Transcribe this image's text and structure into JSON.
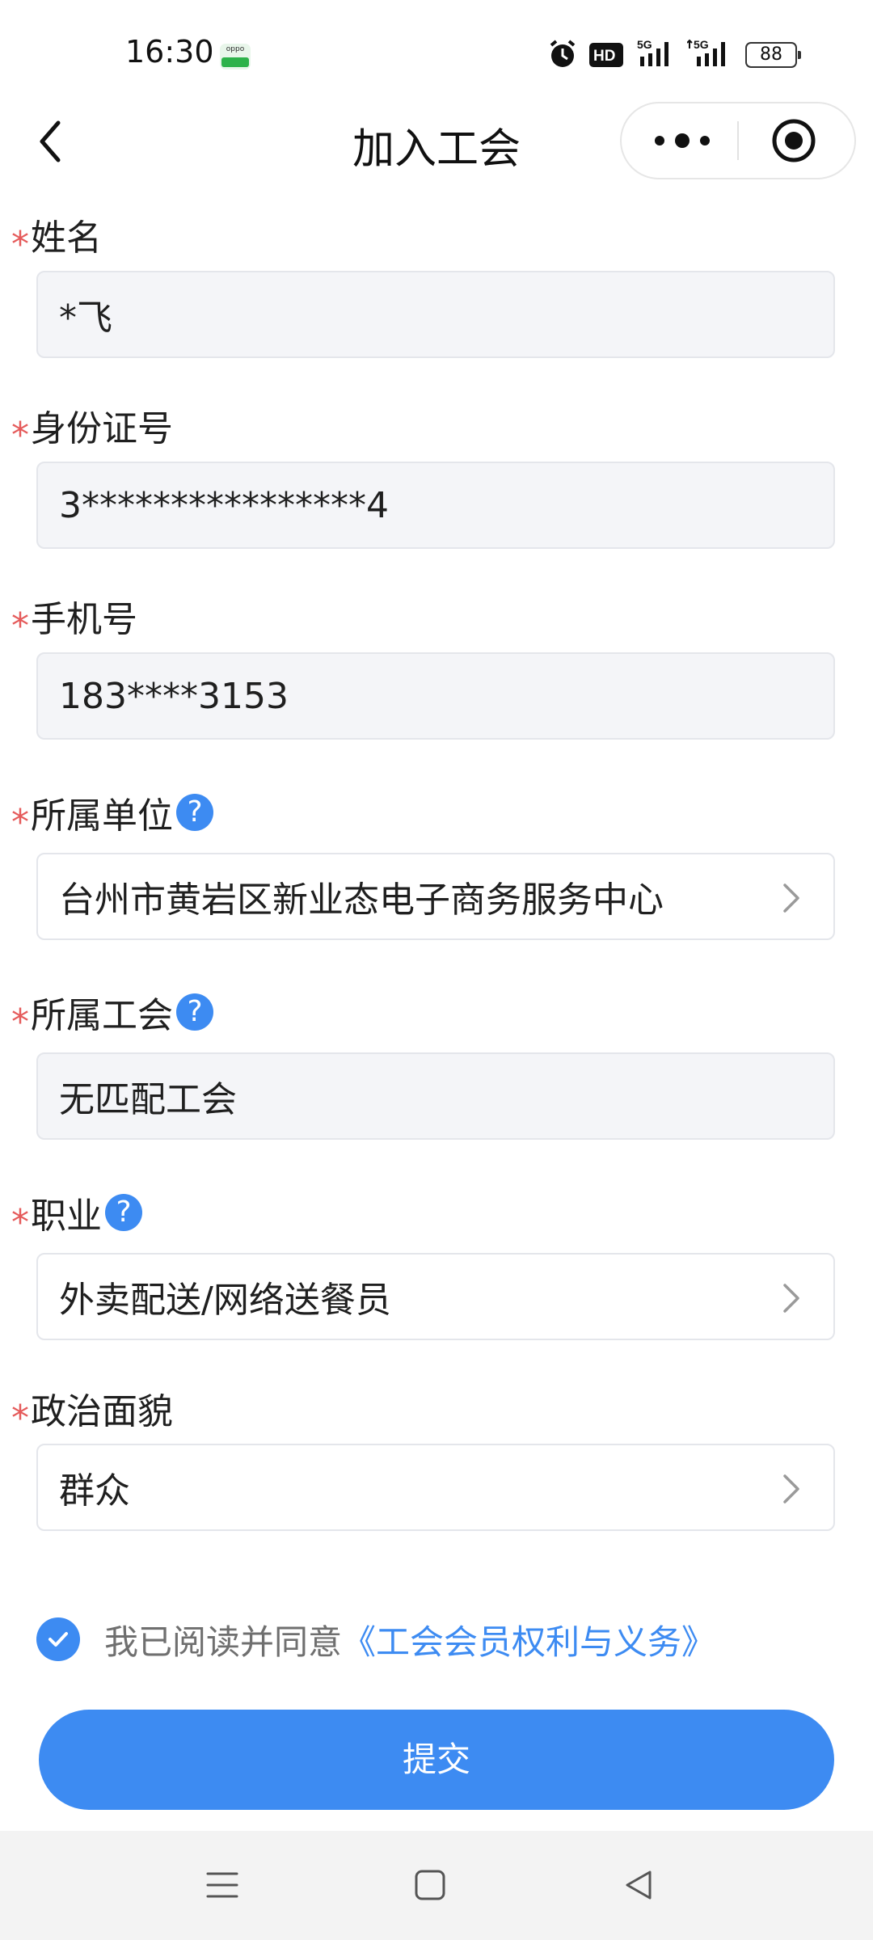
{
  "status_bar": {
    "time": "16:30",
    "app_badge_text": "oppo",
    "battery": "88",
    "icons": [
      "alarm-icon",
      "hd-icon",
      "signal-5g-icon",
      "signal-5g-icon",
      "battery-icon"
    ]
  },
  "nav": {
    "title": "加入工会",
    "back_icon": "chevron-left-icon",
    "more_icon": "more-dots-icon",
    "close_icon": "target-icon"
  },
  "form": {
    "fields": [
      {
        "label": "姓名",
        "value": "*飞",
        "required": true,
        "help": false,
        "type": "readonly"
      },
      {
        "label": "身份证号",
        "value": "3****************4",
        "required": true,
        "help": false,
        "type": "readonly"
      },
      {
        "label": "手机号",
        "value": "183****3153",
        "required": true,
        "help": false,
        "type": "readonly"
      },
      {
        "label": "所属单位",
        "value": "台州市黄岩区新业态电子商务服务中心",
        "required": true,
        "help": true,
        "type": "select"
      },
      {
        "label": "所属工会",
        "value": "无匹配工会",
        "required": true,
        "help": true,
        "type": "readonly"
      },
      {
        "label": "职业",
        "value": "外卖配送/网络送餐员",
        "required": true,
        "help": true,
        "type": "select"
      },
      {
        "label": "政治面貌",
        "value": "群众",
        "required": true,
        "help": false,
        "type": "select"
      }
    ],
    "required_mark": "*",
    "help_mark": "?"
  },
  "agreement": {
    "checked": true,
    "text": "我已阅读并同意",
    "link": "《工会会员权利与义务》"
  },
  "submit_label": "提交",
  "colors": {
    "accent": "#3d8bf2",
    "required": "#e55b5b",
    "readonly_bg": "#f4f5f8"
  }
}
